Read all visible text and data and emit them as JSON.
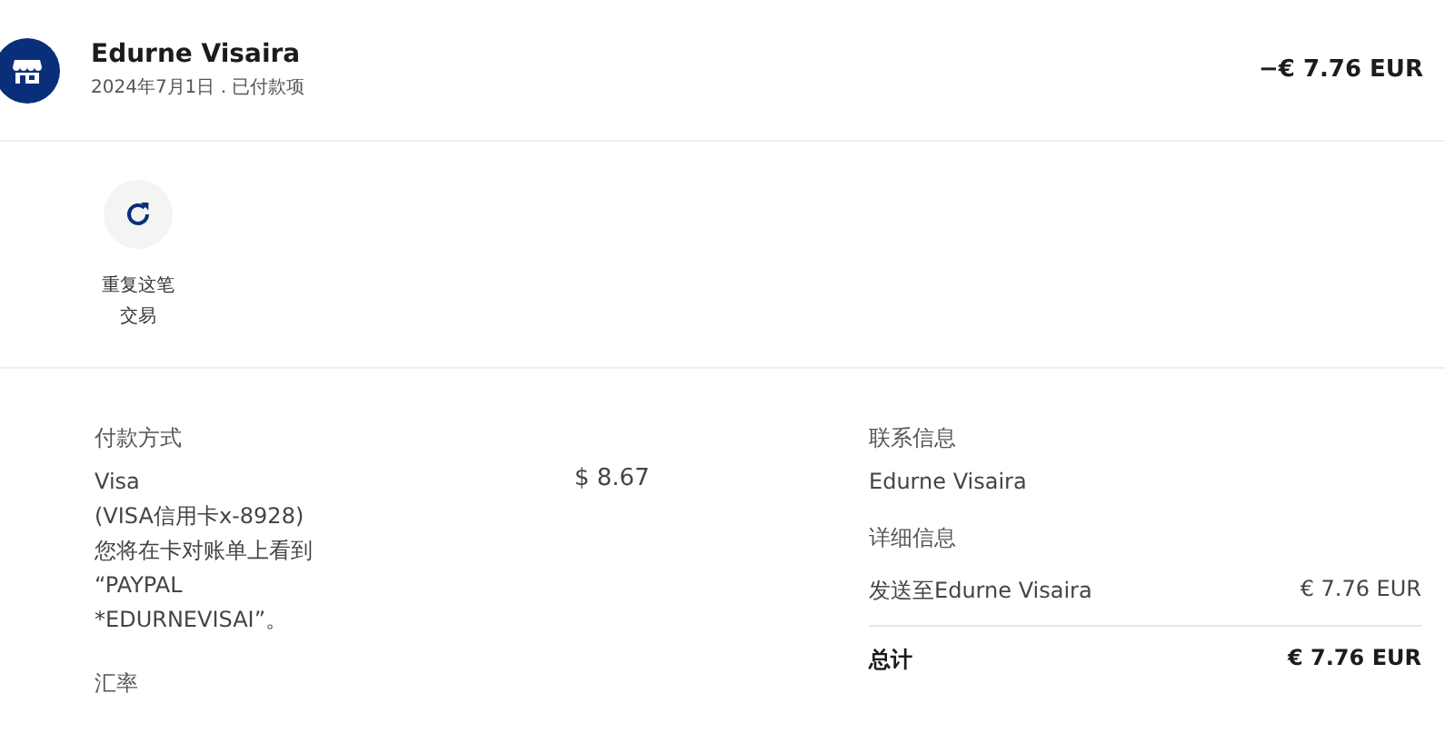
{
  "header": {
    "name": "Edurne Visaira",
    "subtitle": "2024年7月1日 . 已付款项",
    "amount": "−€ 7.76 EUR"
  },
  "actions": [
    {
      "label": "重复这笔交易"
    }
  ],
  "payment": {
    "heading": "付款方式",
    "lines": [
      "Visa",
      "(VISA信用卡x-8928)",
      "您将在卡对账单上看到",
      "“PAYPAL",
      "*EDURNEVISAI”。"
    ],
    "amount": "$ 8.67"
  },
  "exchange": {
    "heading": "汇率"
  },
  "contact": {
    "heading": "联系信息",
    "name": "Edurne Visaira"
  },
  "details": {
    "heading": "详细信息",
    "rows": [
      {
        "label": "发送至Edurne Visaira",
        "value": "€ 7.76 EUR"
      }
    ],
    "total": {
      "label": "总计",
      "value": "€ 7.76 EUR"
    }
  }
}
